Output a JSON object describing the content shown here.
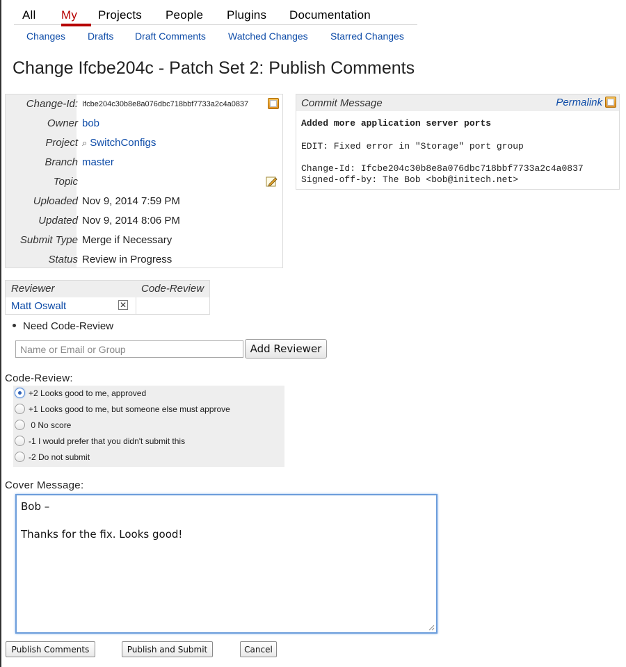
{
  "nav": {
    "tabs": [
      "All",
      "My",
      "Projects",
      "People",
      "Plugins",
      "Documentation"
    ],
    "active_tab": "My",
    "subtabs": [
      "Changes",
      "Drafts",
      "Draft Comments",
      "Watched Changes",
      "Starred Changes"
    ]
  },
  "page_title": "Change Ifcbe204c - Patch Set 2: Publish Comments",
  "change_info": {
    "labels": {
      "change_id": "Change-Id:",
      "owner": "Owner",
      "project": "Project",
      "branch": "Branch",
      "topic": "Topic",
      "uploaded": "Uploaded",
      "updated": "Updated",
      "submit_type": "Submit Type",
      "status": "Status"
    },
    "values": {
      "change_id": "Ifcbe204c30b8e8a076dbc718bbf7733a2c4a0837",
      "owner": "bob",
      "project": "SwitchConfigs",
      "branch": "master",
      "topic": "",
      "uploaded": "Nov 9, 2014 7:59 PM",
      "updated": "Nov 9, 2014 8:06 PM",
      "submit_type": "Merge if Necessary",
      "status": "Review in Progress"
    }
  },
  "commit_message": {
    "header": "Commit Message",
    "permalink": "Permalink",
    "subject": "Added more application server ports",
    "body": "EDIT: Fixed error in \"Storage\" port group",
    "footer_change_id": "Change-Id: Ifcbe204c30b8e8a076dbc718bbf7733a2c4a0837",
    "footer_signed_off": "Signed-off-by: The Bob <bob@initech.net>"
  },
  "reviewers": {
    "col_reviewer": "Reviewer",
    "col_code_review": "Code-Review",
    "rows": [
      {
        "name": "Matt Oswalt",
        "remove": "✕"
      }
    ]
  },
  "need_label": "Need Code-Review",
  "add_reviewer": {
    "placeholder": "Name or Email or Group",
    "button": "Add Reviewer"
  },
  "code_review": {
    "label": "Code-Review:",
    "selected_index": 0,
    "options": [
      "+2 Looks good to me, approved",
      "+1 Looks good to me, but someone else must approve",
      " 0 No score",
      "-1 I would prefer that you didn't submit this",
      "-2 Do not submit"
    ]
  },
  "cover_message": {
    "label": "Cover Message:",
    "text": "Bob –\n\nThanks for the fix. Looks good!"
  },
  "actions": {
    "publish": "Publish Comments",
    "publish_submit": "Publish and Submit",
    "cancel": "Cancel"
  },
  "colors": {
    "link": "#0e4ca8",
    "active_tab": "#b60000",
    "panel_bg": "#eeeeee"
  }
}
